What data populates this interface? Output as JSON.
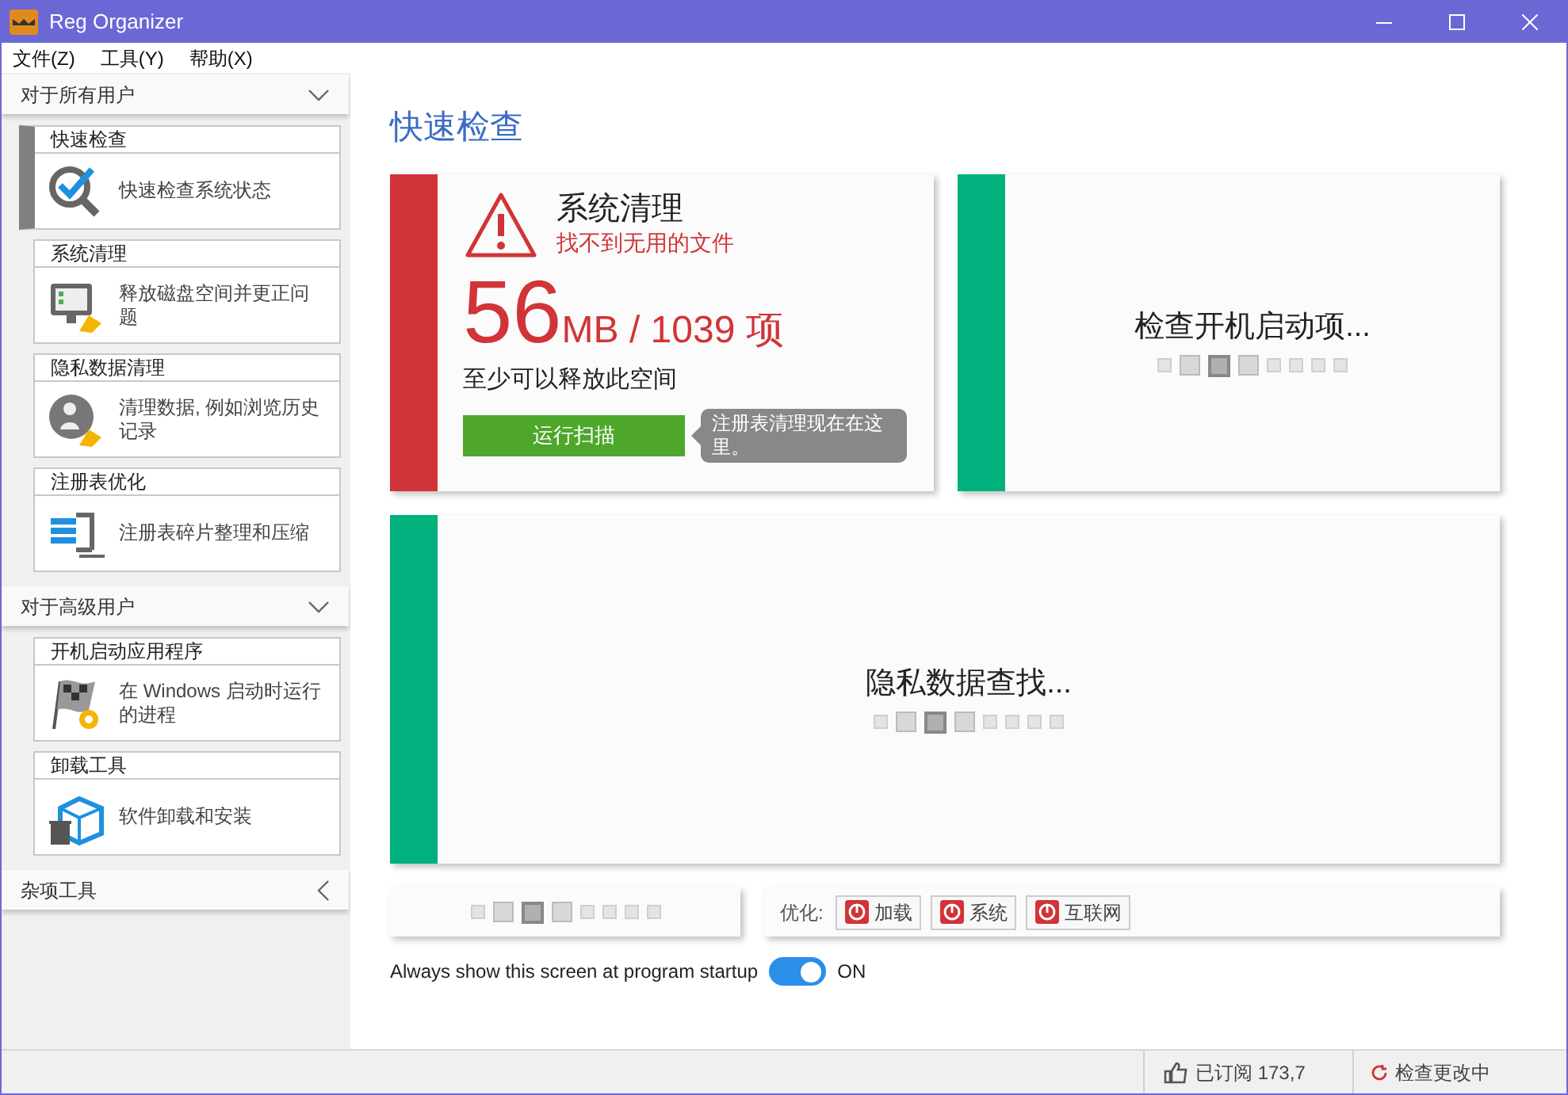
{
  "window": {
    "title": "Reg Organizer"
  },
  "menu": [
    {
      "label": "文件(Z)"
    },
    {
      "label": "工具(Y)"
    },
    {
      "label": "帮助(X)"
    }
  ],
  "sidebar": {
    "groups": [
      {
        "title": "对于所有用户",
        "expanded": true,
        "items": [
          {
            "kind": "check",
            "title": "快速检查",
            "description": "快速检查系统状态",
            "selected": true
          },
          {
            "kind": "clean",
            "title": "系统清理",
            "description": "释放磁盘空间并更正问题",
            "selected": false
          },
          {
            "kind": "privacy",
            "title": "隐私数据清理",
            "description": "清理数据, 例如浏览历史记录",
            "selected": false
          },
          {
            "kind": "registry",
            "title": "注册表优化",
            "description": "注册表碎片整理和压缩",
            "selected": false
          }
        ]
      },
      {
        "title": "对于高级用户",
        "expanded": true,
        "items": [
          {
            "kind": "startup",
            "title": "开机启动应用程序",
            "description": "在 Windows 启动时运行的进程",
            "selected": false
          },
          {
            "kind": "uninstall",
            "title": "卸载工具",
            "description": "软件卸载和安装",
            "selected": false
          }
        ]
      },
      {
        "title": "杂项工具",
        "expanded": false
      }
    ]
  },
  "page_title": "快速检查",
  "cards": [
    {
      "kind": "result",
      "color": "#d13438",
      "title": "系统清理",
      "subtitle": "找不到无用的文件",
      "big_number": "56",
      "unit": "MB / 1039 项",
      "caption": "至少可以释放此空间",
      "button": "运行扫描",
      "tooltip": "注册表清理现在在这里。"
    },
    {
      "kind": "loading",
      "color": "#00b07d",
      "text": "检查开机启动项...",
      "pager": [
        {
          "selected": false
        },
        {
          "selected": false
        },
        {
          "selected": true
        },
        {
          "selected": false
        },
        {
          "selected": false
        },
        {
          "selected": false
        },
        {
          "selected": false
        },
        {
          "selected": false
        }
      ]
    },
    {
      "kind": "loading",
      "color": "#00b07d",
      "text": "隐私数据查找...",
      "pager": [
        {
          "selected": false
        },
        {
          "selected": false
        },
        {
          "selected": true
        },
        {
          "selected": false
        },
        {
          "selected": false
        },
        {
          "selected": false
        },
        {
          "selected": false
        },
        {
          "selected": false
        }
      ]
    }
  ],
  "bottom_pager": [
    {
      "selected": false
    },
    {
      "selected": false
    },
    {
      "selected": true
    },
    {
      "selected": false
    },
    {
      "selected": false
    },
    {
      "selected": false
    },
    {
      "selected": false
    },
    {
      "selected": false
    }
  ],
  "optimize": {
    "label": "优化:",
    "buttons": [
      {
        "label": "加载"
      },
      {
        "label": "系统"
      },
      {
        "label": "互联网"
      }
    ]
  },
  "startup_toggle": {
    "label": "Always show this screen at program startup",
    "on": true,
    "state_text": "ON"
  },
  "status_bar": {
    "subscribed": "已订阅 173,7",
    "checking": "检查更改中"
  }
}
